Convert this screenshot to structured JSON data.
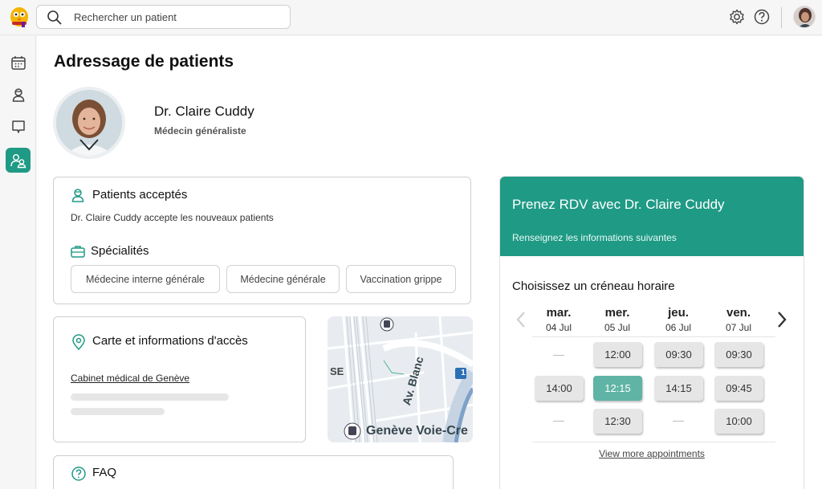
{
  "search": {
    "placeholder": "Rechercher un patient"
  },
  "page": {
    "title": "Adressage de patients"
  },
  "doctor": {
    "name": "Dr. Claire Cuddy",
    "role": "Médecin généraliste"
  },
  "patients": {
    "heading": "Patients acceptés",
    "text": "Dr. Claire Cuddy accepte les nouveaux patients"
  },
  "specialties": {
    "heading": "Spécialités",
    "items": [
      "Médecine interne générale",
      "Médecine générale",
      "Vaccination grippe"
    ]
  },
  "access": {
    "heading": "Carte et informations d'accès",
    "clinic_link": "Cabinet médical de Genève"
  },
  "map": {
    "street": "Av. Blanc",
    "station": "Genève Voie-Cre",
    "edge_label": "SE",
    "route_badge": "1"
  },
  "faq": {
    "heading": "FAQ"
  },
  "booking": {
    "title": "Prenez RDV avec Dr. Claire Cuddy",
    "subtitle": "Renseignez les informations suivantes",
    "slot_heading": "Choisissez un créneau horaire",
    "days": [
      {
        "name": "mar.",
        "date": "04 Jul"
      },
      {
        "name": "mer.",
        "date": "05 Jul"
      },
      {
        "name": "jeu.",
        "date": "06 Jul"
      },
      {
        "name": "ven.",
        "date": "07 Jul"
      }
    ],
    "slots": {
      "r1": [
        "",
        "12:00",
        "09:30",
        "09:30"
      ],
      "r2": [
        "14:00",
        "12:15",
        "14:15",
        "09:45"
      ],
      "r3": [
        "",
        "12:30",
        "",
        "10:00"
      ]
    },
    "selected_slot": "12:15",
    "more_link": "View more appointments"
  },
  "colors": {
    "accent": "#1f9a85",
    "selected_slot": "#5fb4a6"
  }
}
